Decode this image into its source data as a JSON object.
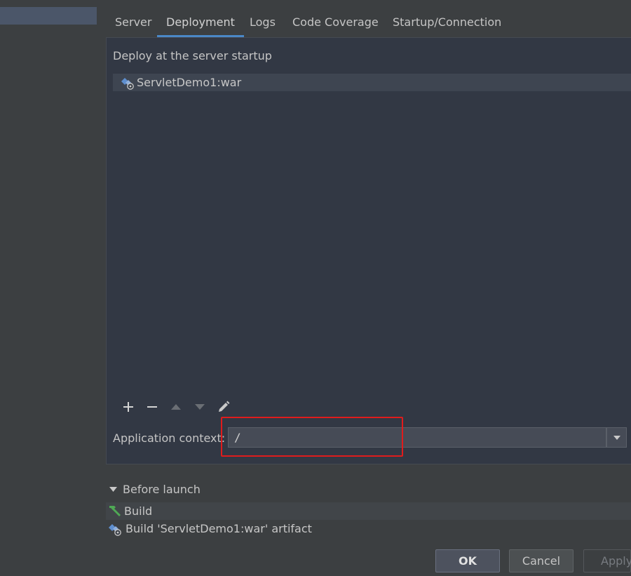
{
  "tabs": [
    {
      "label": "Server"
    },
    {
      "label": "Deployment"
    },
    {
      "label": "Logs"
    },
    {
      "label": "Code Coverage"
    },
    {
      "label": "Startup/Connection"
    }
  ],
  "active_tab": "Deployment",
  "deployment": {
    "section_label": "Deploy at the server startup",
    "artifacts": [
      {
        "label": "ServletDemo1:war",
        "icon": "artifact-icon"
      }
    ],
    "toolbar": [
      "add-icon",
      "remove-icon",
      "move-up-icon",
      "move-down-icon",
      "edit-icon"
    ],
    "context_label": "Application context:",
    "context_value": "/"
  },
  "before_launch": {
    "label": "Before launch",
    "items": [
      {
        "label": "Build",
        "icon": "hammer-icon"
      },
      {
        "label": "Build 'ServletDemo1:war' artifact",
        "icon": "artifact-icon"
      }
    ]
  },
  "buttons": {
    "ok": "OK",
    "cancel": "Cancel",
    "apply": "Apply"
  },
  "colors": {
    "accent": "#4a88c7",
    "highlight": "#e01c1c",
    "panel": "#323844"
  }
}
